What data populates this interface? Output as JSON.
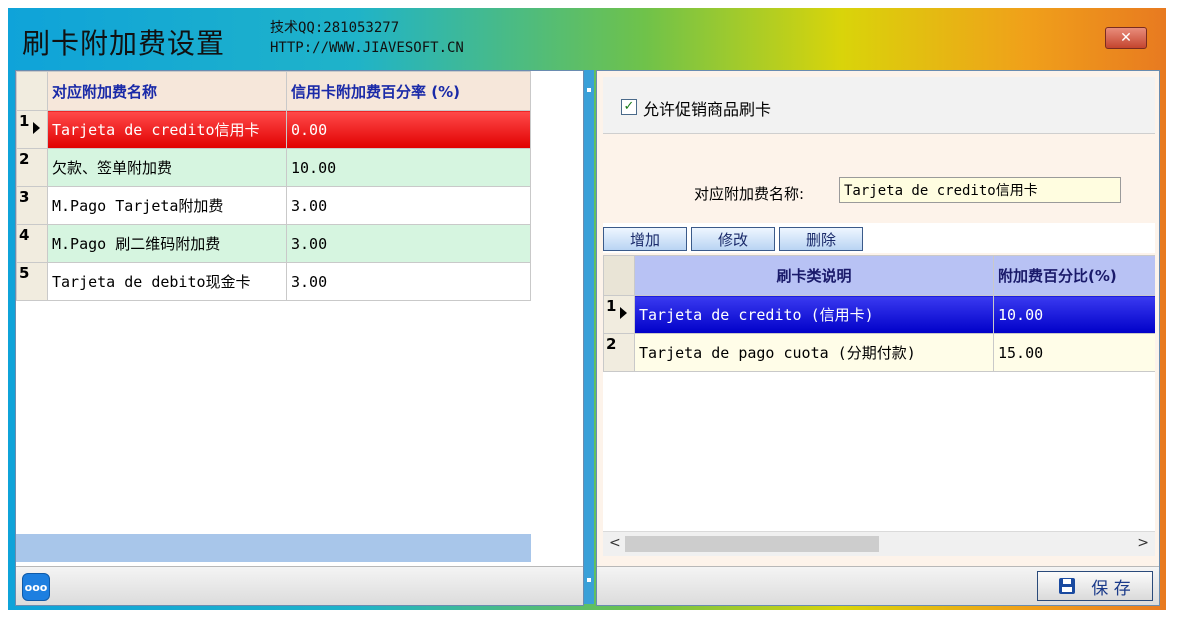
{
  "window": {
    "title": "刷卡附加费设置",
    "tech_line1": "技术QQ:281053277",
    "tech_line2": "HTTP://WWW.JIAVESOFT.CN",
    "close_icon": "close-icon"
  },
  "left_grid": {
    "headers": [
      "对应附加费名称",
      "信用卡附加费百分率 (%)"
    ],
    "rows": [
      {
        "idx": "1",
        "name": "Tarjeta de credito信用卡",
        "pct": "0.00"
      },
      {
        "idx": "2",
        "name": "欠款、签单附加费",
        "pct": "10.00"
      },
      {
        "idx": "3",
        "name": "M.Pago Tarjeta附加费",
        "pct": "3.00"
      },
      {
        "idx": "4",
        "name": "M.Pago 刷二维码附加费",
        "pct": "3.00"
      },
      {
        "idx": "5",
        "name": "Tarjeta de debito现金卡",
        "pct": "3.00"
      }
    ]
  },
  "status_left_icon": "ooo",
  "right": {
    "allow_promo_label": "允许促销商品刷卡",
    "allow_promo_checked": true,
    "name_label": "对应附加费名称:",
    "name_value": "Tarjeta de credito信用卡",
    "buttons": {
      "add": "增加",
      "edit": "修改",
      "delete": "删除"
    },
    "grid": {
      "headers": [
        "刷卡类说明",
        "附加费百分比(%)"
      ],
      "rows": [
        {
          "idx": "1",
          "desc": "Tarjeta de credito (信用卡)",
          "pct": "10.00"
        },
        {
          "idx": "2",
          "desc": "Tarjeta de pago cuota (分期付款)",
          "pct": "15.00"
        }
      ]
    },
    "save_label": "保 存"
  },
  "colors": {
    "selected_left": "#e00000",
    "selected_right": "#0000c8",
    "accent": "#1a2aa8"
  }
}
